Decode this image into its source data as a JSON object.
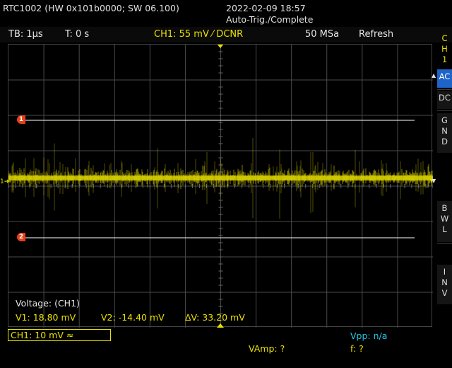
{
  "header": {
    "device": "RTC1002 (HW 0x101b0000; SW 06.100)",
    "datetime": "2022-02-09 18:57",
    "status": "Auto-Trig./Complete"
  },
  "topbar": {
    "timebase": "TB: 1µs",
    "trigger_time": "T: 0 s",
    "ch1_info": "CH1: 55 mV ⁄ DCNR",
    "sample_rate": "50 MSa",
    "mode": "Refresh"
  },
  "sidebar": {
    "channel_label": [
      "C",
      "H",
      "1"
    ],
    "buttons": [
      {
        "label": [
          "AC"
        ],
        "active": true
      },
      {
        "label": [
          "DC"
        ],
        "active": false
      },
      {
        "label": [
          "G",
          "N",
          "D"
        ],
        "active": false
      },
      {
        "label": [
          "B",
          "W",
          "L"
        ],
        "active": false
      },
      {
        "label": [
          "I",
          "N",
          "V"
        ],
        "active": false
      }
    ]
  },
  "cursors": {
    "marker1": "1",
    "marker2": "2",
    "ground_marker": "1",
    "readout_title": "Voltage: (CH1)",
    "v1": "V1: 18.80 mV",
    "v2": "V2: -14.40 mV",
    "dv": "ΔV: 33.20 mV"
  },
  "footer": {
    "ch1_scale": "CH1: 10 mV ≈",
    "vpp": "Vpp: n/a",
    "vamp": "VAmp: ?",
    "freq": "f: ?"
  },
  "colors": {
    "trace": "#e8e000",
    "cursor_line": "#ffffff",
    "marker": "#e84018",
    "grid": "#4a4a4a",
    "active_button": "#1f64c8",
    "measurement_cyan": "#22c8e8"
  }
}
